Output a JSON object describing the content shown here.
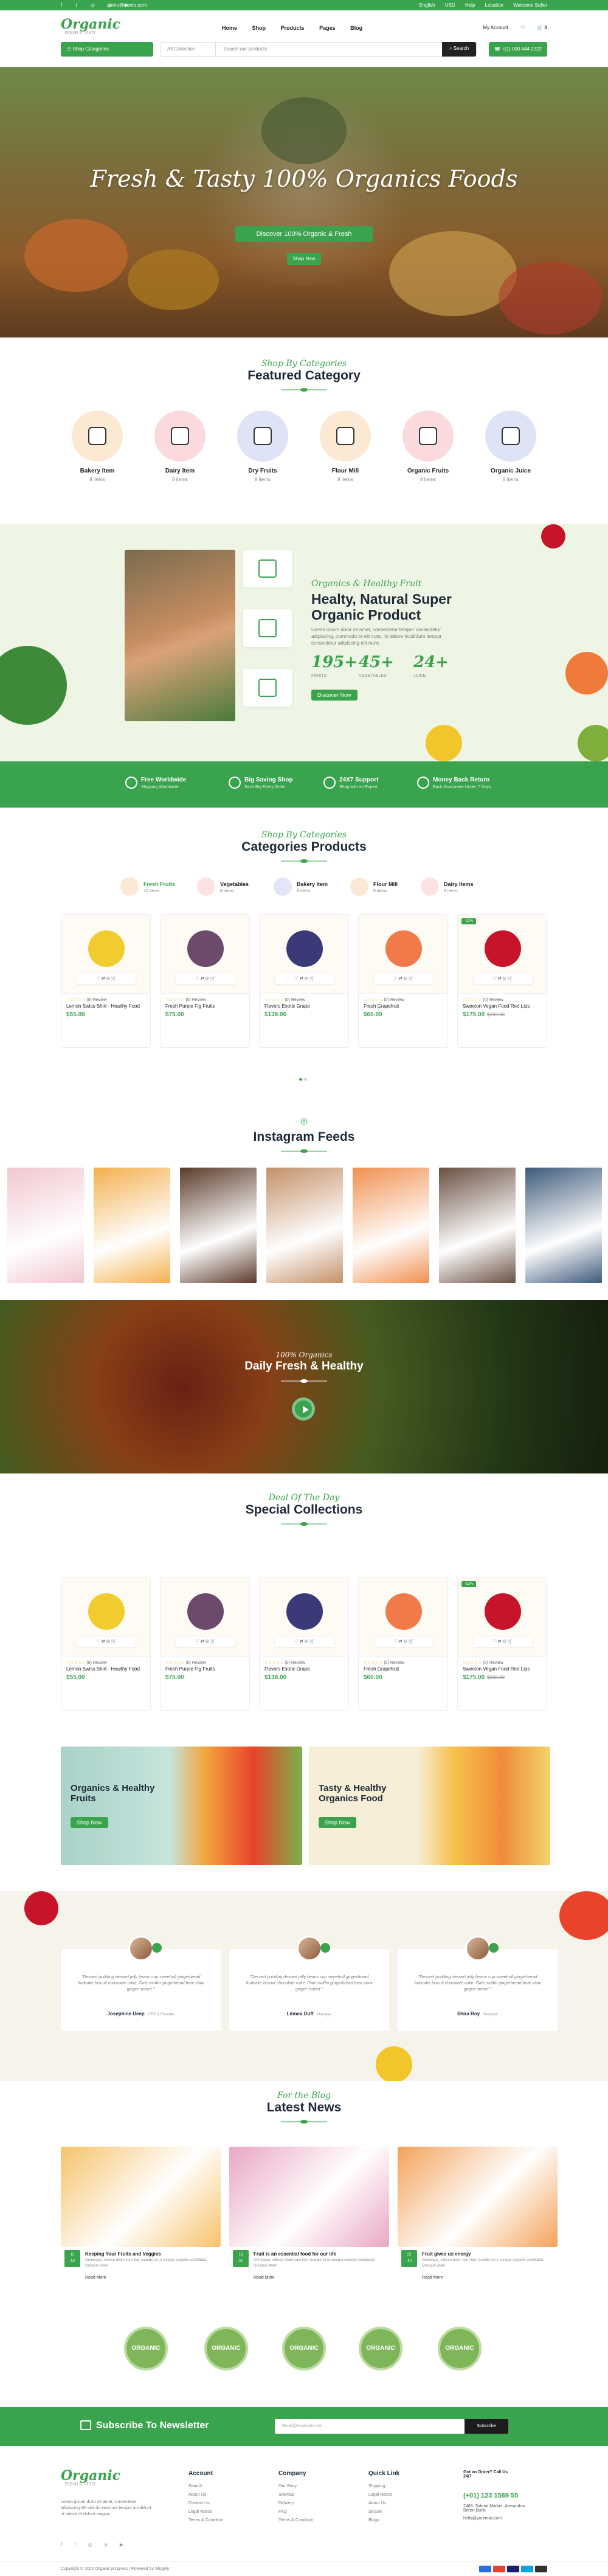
{
  "topbar": {
    "social_icons": [
      "facebook-icon",
      "twitter-icon",
      "instagram-icon",
      "pinterest-icon",
      "youtube-icon"
    ],
    "email": "demo@demo.com",
    "language": "English",
    "currency": "USD",
    "links": [
      "Help",
      "Location",
      "Welcome Seller"
    ]
  },
  "header": {
    "logo": "Organic",
    "logo_tagline": "FRESH & TASTY",
    "nav": [
      "Home",
      "Shop",
      "Products",
      "Pages",
      "Blog"
    ],
    "account": "My Account",
    "cart": "0",
    "browse": "Shop Categories",
    "search_scope": "All Collection",
    "search_placeholder": "Search our products",
    "search_button": "Search",
    "phone": "+(1) 000 444 2222"
  },
  "hero": {
    "title": "Fresh & Tasty 100% Organics Foods",
    "subtitle": "Discover 100% Organic & Fresh",
    "button": "Shop Now"
  },
  "featured": {
    "script": "Shop By Categories",
    "title": "Featured Category",
    "items": [
      {
        "name": "Bakery Item",
        "count": "8 items",
        "color": "#fbe9d3"
      },
      {
        "name": "Dairy Item",
        "count": "8 items",
        "color": "#fbdadd"
      },
      {
        "name": "Dry Fruits",
        "count": "8 items",
        "color": "#dfe3f6"
      },
      {
        "name": "Flour Mill",
        "count": "8 items",
        "color": "#fbe9d3"
      },
      {
        "name": "Organic Fruits",
        "count": "8 items",
        "color": "#fbdadd"
      },
      {
        "name": "Organic Juice",
        "count": "8 items",
        "color": "#dfe3f6"
      }
    ]
  },
  "promo": {
    "script": "Organics & Healthy Fruit",
    "title": "Healty, Natural Super Organic Product",
    "text": "Lorem ipsum dolor sit amet, consectetur tempor consectetur adipiscing, commodo in elit nunc. In labore incididunt tempor consectetur adipiscing elit nunc.",
    "stats": [
      {
        "value": "195+",
        "label": "FRUITS"
      },
      {
        "value": "45+",
        "label": "VEGETABLES"
      },
      {
        "value": "24+",
        "label": "JUICE"
      }
    ],
    "button": "Discover Now"
  },
  "features": [
    {
      "title": "Free Worldwide",
      "sub": "Shipping Worldwide"
    },
    {
      "title": "Big Saving Shop",
      "sub": "Save Big Every Order"
    },
    {
      "title": "24X7 Support",
      "sub": "Shop with an Expert"
    },
    {
      "title": "Money Back Return",
      "sub": "Back Guarantee Under 7 Days"
    }
  ],
  "catprod": {
    "script": "Shop By Categories",
    "title": "Categories Products",
    "tabs": [
      {
        "name": "Fresh Fruits",
        "count": "10 items"
      },
      {
        "name": "Vegetables",
        "count": "8 items"
      },
      {
        "name": "Bakery Item",
        "count": "8 items"
      },
      {
        "name": "Flour Mill",
        "count": "8 items"
      },
      {
        "name": "Dairy Items",
        "count": "6 items"
      }
    ]
  },
  "products": [
    {
      "name": "Lemon Swiss Shirt - Healthy Food",
      "price": "$55.00",
      "old": "",
      "reviews": "(0) Review",
      "badge": "",
      "color": "#f0cc2e",
      "tools": "♡  ⇄  ◎  🛒"
    },
    {
      "name": "Fresh Purple Fig Fruits",
      "price": "$75.00",
      "old": "",
      "reviews": "(0) Review",
      "badge": "",
      "color": "#6b4a6b",
      "tools": "♡  ⇄  ◎  🛒"
    },
    {
      "name": "Flavors Exotic Grape",
      "price": "$138.00",
      "old": "",
      "reviews": "(0) Review",
      "badge": "",
      "color": "#3b3a78",
      "tools": "♡  ⇄  ◎  🛒"
    },
    {
      "name": "Fresh Grapefruit",
      "price": "$60.00",
      "old": "",
      "reviews": "(0) Review",
      "badge": "",
      "color": "#f07a4a",
      "tools": "♡  ⇄  ◎  🛒"
    },
    {
      "name": "Sweeton Vegan Food Red Lips",
      "price": "$175.00",
      "old": "$200.00",
      "reviews": "(0) Review",
      "badge": "-12%",
      "color": "#c8142b",
      "tools": "♡  ⇄  ◎  🛒"
    }
  ],
  "instagram": {
    "title": "Instagram Feeds",
    "icon": "instagram-icon",
    "images": [
      {
        "name": "smoothie",
        "color": "#f1c7d0"
      },
      {
        "name": "fruit-bowl",
        "color": "#f3b04e"
      },
      {
        "name": "cooking-hands",
        "color": "#5b3b2a"
      },
      {
        "name": "bread-board",
        "color": "#c49067"
      },
      {
        "name": "juice-glass",
        "color": "#f09050"
      },
      {
        "name": "baking",
        "color": "#6a5042"
      },
      {
        "name": "family-cooking",
        "color": "#3d5a7a"
      }
    ]
  },
  "daily": {
    "script": "100% Organics",
    "title": "Daily Fresh & Healthy"
  },
  "special": {
    "script": "Deal Of The Day",
    "title": "Special Collections"
  },
  "banners": [
    {
      "title": "Organics & Healthy Fruits",
      "button": "Shop Now",
      "color": "#a9d3c8"
    },
    {
      "title": "Tasty & Healthy Organics Food",
      "button": "Shop Now",
      "color": "#f7eed7"
    }
  ],
  "testimonials": [
    {
      "text": "\"Dessert pudding dessert jelly beans cup sweetroll gingerbread fruitcake biscuit chocolate cake. Oatz muffin gingerbread bear claw ginger sorbet.\"",
      "name": "Josephine Deep",
      "role": "CEO & Founder"
    },
    {
      "text": "\"Dessert pudding dessert jelly beans cup sweetroll gingerbread fruitcake biscuit chocolate cake. Oatz muffin gingerbread bear claw ginger sorbet.\"",
      "name": "Linnea Duff",
      "role": "Manager"
    },
    {
      "text": "\"Dessert pudding dessert jelly beans cup sweetroll gingerbread fruitcake biscuit chocolate cake. Oatz muffin gingerbread bear claw ginger sorbet.\"",
      "name": "Shira Roy",
      "role": "Designer"
    }
  ],
  "news": {
    "script": "For the Blog",
    "title": "Latest News",
    "items": [
      {
        "day": "12",
        "month": "Jul",
        "title": "Keeping Your Fruits and Veggies",
        "excerpt": "Omnisque, vidisse ullam sunt litoi, cuando sit ut congue corporis volatilidad. Quisque vitae!",
        "more": "Read More",
        "color": "#f6c36a"
      },
      {
        "day": "18",
        "month": "Jul",
        "title": "Fruit is an essential food for our life",
        "excerpt": "Omnisque, vidisse ullam sunt litoi, cuando sit ut congue corporis volatilidad. Quisque vitae!",
        "more": "Read More",
        "color": "#e9a7c4"
      },
      {
        "day": "22",
        "month": "Jul",
        "title": "Fruit gives us energy",
        "excerpt": "Omnisque, vidisse ullam sunt litoi, cuando sit ut congue corporis volatilidad. Quisque vitae!",
        "more": "Read More",
        "color": "#f4a25a"
      }
    ]
  },
  "badges": [
    "ORGANIC",
    "ORGANIC",
    "ORGANIC",
    "ORGANIC",
    "ORGANIC"
  ],
  "newsletter": {
    "title": "Subscribe To Newsletter",
    "placeholder": "Email@example.com",
    "button": "Subscribe"
  },
  "footer": {
    "about": "Lorem ipsum dolor sit amet, consectetur adipiscing elit sed do eiusmod tempor incididunt ut labore et dolore magna.",
    "columns": [
      {
        "title": "Account",
        "links": [
          "Search",
          "About Us",
          "Contact Us",
          "Legal Notice",
          "Terms & Condition"
        ]
      },
      {
        "title": "Company",
        "links": [
          "Our Story",
          "Sitemap",
          "Delivery",
          "FAQ",
          "Terms & Condition"
        ]
      },
      {
        "title": "Quick Link",
        "links": [
          "Shipping",
          "Legal Notice",
          "About Us",
          "Secure",
          "Blogs"
        ]
      }
    ],
    "call_title": "Got an Order? Call Us 24/7",
    "phone": "(+01) 123 1569 55",
    "address": "2468, Sideral Market, Alexandria Breen Bunk",
    "email": "hello@yourmail.com",
    "social": [
      "facebook-icon",
      "twitter-icon",
      "instagram-icon",
      "pinterest-icon",
      "youtube-icon"
    ],
    "copyright": "Copyright © 2022 Organic progress | Powered by Shopify",
    "payments": [
      "#2a6fdb",
      "#e8412c",
      "#1a1f71",
      "#00a5e0",
      "#333333"
    ]
  }
}
